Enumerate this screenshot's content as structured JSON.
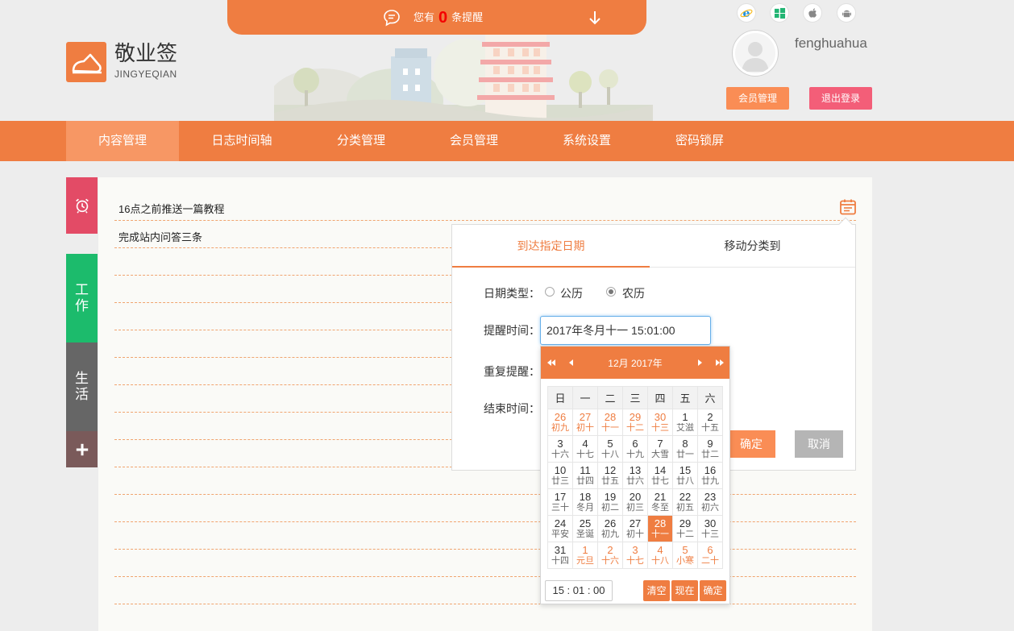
{
  "header": {
    "notice_prefix": "您有",
    "notice_count": "0",
    "notice_suffix": "条提醒",
    "logo_title": "敬业签",
    "logo_sub": "JINGYEQIAN",
    "username": "fenghuahua",
    "member_button": "会员管理",
    "logout_button": "退出登录",
    "os_icons": [
      "ie-icon",
      "windows-icon",
      "apple-icon",
      "android-icon"
    ]
  },
  "nav": {
    "items": [
      "内容管理",
      "日志时间轴",
      "分类管理",
      "会员管理",
      "系统设置",
      "密码锁屏"
    ],
    "active_index": 0
  },
  "sidebar": {
    "tabs": [
      {
        "name": "alarm-icon",
        "label": ""
      },
      {
        "name": "work",
        "label": "工作"
      },
      {
        "name": "life",
        "label": "生活"
      },
      {
        "name": "add-icon",
        "label": "+"
      }
    ]
  },
  "tasks": [
    "16点之前推送一篇教程",
    "完成站内问答三条"
  ],
  "popup": {
    "tab_date": "到达指定日期",
    "tab_move": "移动分类到",
    "date_type_label": "日期类型：",
    "option_solar": "公历",
    "option_lunar": "农历",
    "selected_option": "农历",
    "remind_time_label": "提醒时间：",
    "remind_time_value": "2017年冬月十一 15:01:00",
    "repeat_label": "重复提醒：",
    "end_time_label": "结束时间：",
    "confirm_button": "确定",
    "cancel_button": "取消"
  },
  "calendar": {
    "title": "12月 2017年",
    "weekdays": [
      "日",
      "一",
      "二",
      "三",
      "四",
      "五",
      "六"
    ],
    "weeks": [
      [
        [
          "26",
          "初九",
          1
        ],
        [
          "27",
          "初十",
          1
        ],
        [
          "28",
          "十一",
          1
        ],
        [
          "29",
          "十二",
          1
        ],
        [
          "30",
          "十三",
          1
        ],
        [
          "1",
          "艾滋",
          0
        ],
        [
          "2",
          "十五",
          0
        ]
      ],
      [
        [
          "3",
          "十六",
          0
        ],
        [
          "4",
          "十七",
          0
        ],
        [
          "5",
          "十八",
          0
        ],
        [
          "6",
          "十九",
          0
        ],
        [
          "7",
          "大雪",
          0
        ],
        [
          "8",
          "廿一",
          0
        ],
        [
          "9",
          "廿二",
          0
        ]
      ],
      [
        [
          "10",
          "廿三",
          0
        ],
        [
          "11",
          "廿四",
          0
        ],
        [
          "12",
          "廿五",
          0
        ],
        [
          "13",
          "廿六",
          0
        ],
        [
          "14",
          "廿七",
          0
        ],
        [
          "15",
          "廿八",
          0
        ],
        [
          "16",
          "廿九",
          0
        ]
      ],
      [
        [
          "17",
          "三十",
          0
        ],
        [
          "18",
          "冬月",
          0
        ],
        [
          "19",
          "初二",
          0
        ],
        [
          "20",
          "初三",
          0
        ],
        [
          "21",
          "冬至",
          0
        ],
        [
          "22",
          "初五",
          0
        ],
        [
          "23",
          "初六",
          0
        ]
      ],
      [
        [
          "24",
          "平安",
          0
        ],
        [
          "25",
          "圣诞",
          0
        ],
        [
          "26",
          "初九",
          0
        ],
        [
          "27",
          "初十",
          0
        ],
        [
          "28",
          "十一",
          2
        ],
        [
          "29",
          "十二",
          0
        ],
        [
          "30",
          "十三",
          0
        ]
      ],
      [
        [
          "31",
          "十四",
          0
        ],
        [
          "1",
          "元旦",
          1
        ],
        [
          "2",
          "十六",
          1
        ],
        [
          "3",
          "十七",
          1
        ],
        [
          "4",
          "十八",
          1
        ],
        [
          "5",
          "小寒",
          1
        ],
        [
          "6",
          "二十",
          1
        ]
      ]
    ],
    "selected_day": "28",
    "time_value": "15 : 01 : 00",
    "clear_button": "清空",
    "now_button": "现在",
    "ok_button": "确定"
  },
  "colors": {
    "accent": "#ef7d41",
    "nav_active": "#f79764",
    "alarm_tab": "#e34b66",
    "work_tab": "#1cbb6c",
    "life_tab": "#666666",
    "add_tab": "#7a5a5a",
    "logout": "#f35e78"
  }
}
